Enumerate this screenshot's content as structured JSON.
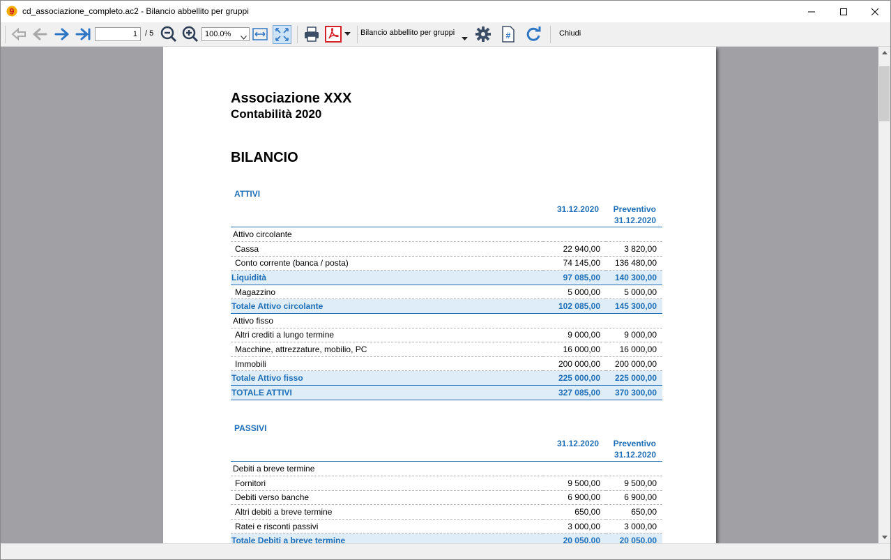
{
  "window": {
    "title": "cd_associazione_completo.ac2 - Bilancio abbellito per gruppi"
  },
  "toolbar": {
    "page_current": "1",
    "page_total": "/ 5",
    "zoom": "100.0%",
    "report_name": "Bilancio abbellito per gruppi",
    "close_label": "Chiudi"
  },
  "colors": {
    "accent": "#1e6fb8",
    "total_row_bg": "#deedf7",
    "pdf_red": "#d32027"
  },
  "report": {
    "org_name": "Associazione XXX",
    "subtitle": "Contabilità 2020",
    "title": "BILANCIO",
    "attivi": {
      "title": "ATTIVI",
      "col1": "31.12.2020",
      "col2_line1": "Preventivo",
      "col2_line2": "31.12.2020",
      "rows": [
        {
          "type": "group",
          "label": "Attivo circolante",
          "v1": "",
          "v2": ""
        },
        {
          "type": "item",
          "label": "Cassa",
          "v1": "22 940,00",
          "v2": "3 820,00"
        },
        {
          "type": "item",
          "label": "Conto corrente (banca / posta)",
          "v1": "74 145,00",
          "v2": "136 480,00"
        },
        {
          "type": "total",
          "label": "Liquidità",
          "v1": "97 085,00",
          "v2": "140 300,00"
        },
        {
          "type": "item",
          "label": "Magazzino",
          "v1": "5 000,00",
          "v2": "5 000,00"
        },
        {
          "type": "total",
          "label": "Totale Attivo circolante",
          "v1": "102 085,00",
          "v2": "145 300,00"
        },
        {
          "type": "group",
          "label": "Attivo fisso",
          "v1": "",
          "v2": ""
        },
        {
          "type": "item",
          "label": "Altri crediti a lungo termine",
          "v1": "9 000,00",
          "v2": "9 000,00"
        },
        {
          "type": "item",
          "label": "Macchine, attrezzature, mobilio, PC",
          "v1": "16 000,00",
          "v2": "16 000,00"
        },
        {
          "type": "item",
          "label": "Immobili",
          "v1": "200 000,00",
          "v2": "200 000,00"
        },
        {
          "type": "total",
          "label": "Totale Attivo fisso",
          "v1": "225 000,00",
          "v2": "225 000,00"
        },
        {
          "type": "total",
          "label": "TOTALE ATTIVI",
          "v1": "327 085,00",
          "v2": "370 300,00"
        }
      ]
    },
    "passivi": {
      "title": "PASSIVI",
      "col1": "31.12.2020",
      "col2_line1": "Preventivo",
      "col2_line2": "31.12.2020",
      "rows": [
        {
          "type": "group",
          "label": "Debiti a breve termine",
          "v1": "",
          "v2": ""
        },
        {
          "type": "item",
          "label": "Fornitori",
          "v1": "9 500,00",
          "v2": "9 500,00"
        },
        {
          "type": "item",
          "label": "Debiti verso banche",
          "v1": "6 900,00",
          "v2": "6 900,00"
        },
        {
          "type": "item",
          "label": "Altri debiti a breve termine",
          "v1": "650,00",
          "v2": "650,00"
        },
        {
          "type": "item",
          "label": "Ratei e risconti passivi",
          "v1": "3 000,00",
          "v2": "3 000,00"
        },
        {
          "type": "total",
          "label": "Totale Debiti a breve termine",
          "v1": "20 050,00",
          "v2": "20 050,00"
        }
      ]
    }
  }
}
